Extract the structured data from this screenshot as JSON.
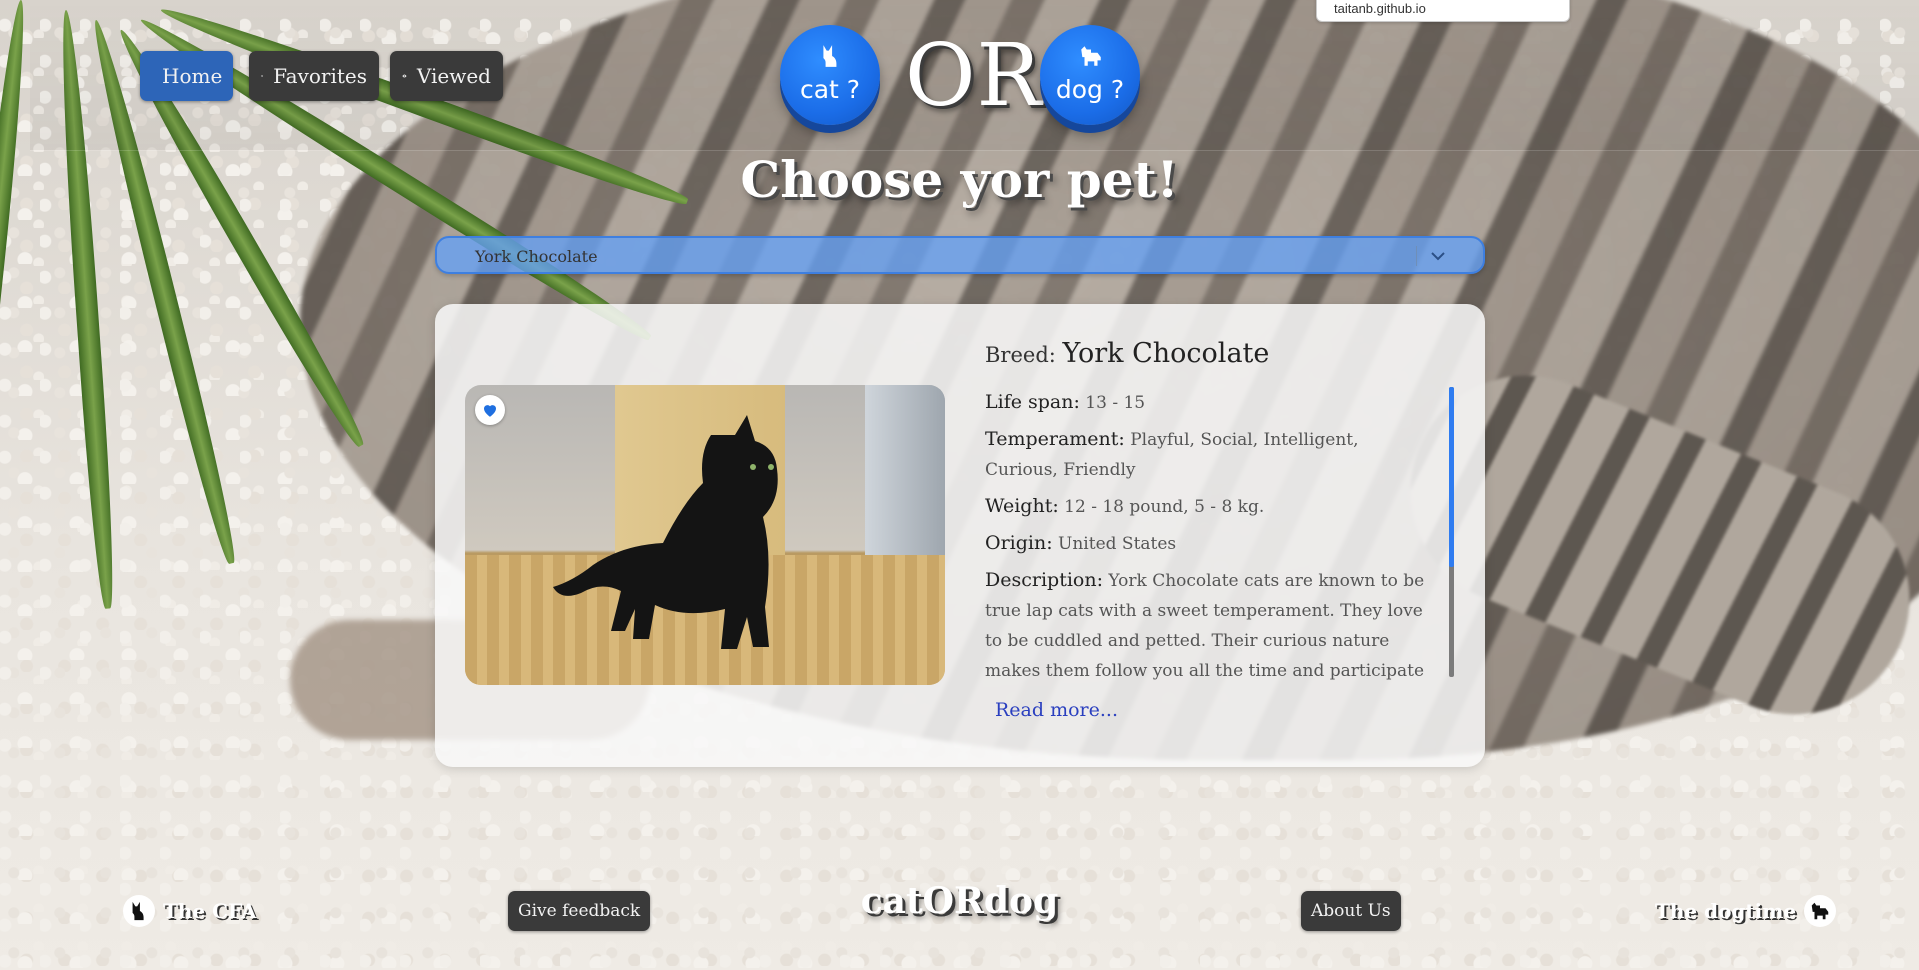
{
  "browser": {
    "url_tooltip": "taitanb.github.io"
  },
  "nav": {
    "home_label": "Home",
    "favorites_label": "Favorites",
    "viewed_label": "Viewed"
  },
  "header": {
    "cat_label": "cat ?",
    "or_label": "OR",
    "dog_label": "dog ?"
  },
  "title": "Choose yor pet!",
  "breed_select": {
    "selected": "York Chocolate"
  },
  "card": {
    "breed_label": "Breed:",
    "breed_value": "York Chocolate",
    "favorite_state": "favorited",
    "fields": [
      {
        "label": "Life span:",
        "value": "13 - 15"
      },
      {
        "label": "Temperament:",
        "value": "Playful, Social, Intelligent, Curious, Friendly"
      },
      {
        "label": "Weight:",
        "value": "12 - 18 pound, 5 - 8 kg."
      },
      {
        "label": "Origin:",
        "value": "United States"
      },
      {
        "label": "Description:",
        "value": "York Chocolate cats are known to be true lap cats with a sweet temperament. They love to be cuddled and petted. Their curious nature makes them follow you all the time and participate in almost everything you do, even if it's related to water."
      }
    ],
    "read_more": "Read more..."
  },
  "footer": {
    "cfa_label": "The CFA",
    "feedback_label": "Give feedback",
    "brand": "catORdog",
    "about_label": "About Us",
    "dogtime_label": "The dogtime"
  },
  "colors": {
    "accent_blue": "#2d65b8",
    "circle_blue": "#1b6de8",
    "button_dark": "#3a3a3a",
    "link_blue": "#2a3fbf"
  },
  "icons": [
    "home-icon",
    "heart-icon",
    "eye-icon",
    "cat-icon",
    "dog-icon",
    "chevron-down-icon"
  ]
}
